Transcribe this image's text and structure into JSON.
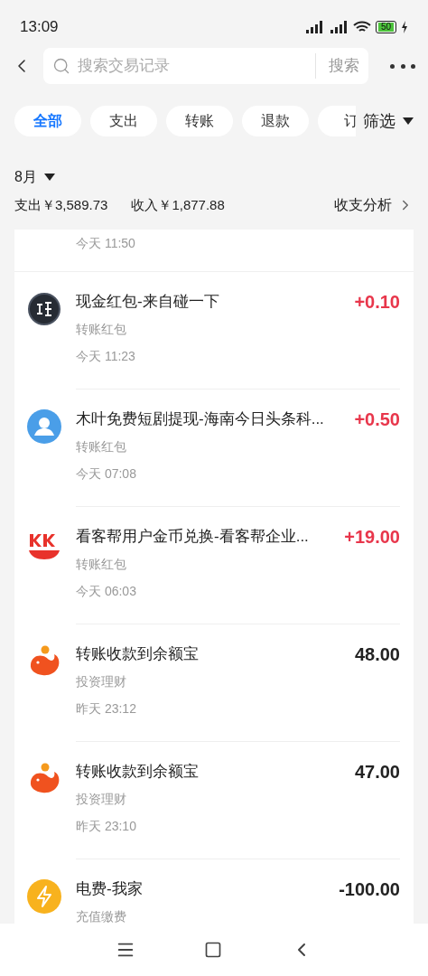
{
  "status_bar": {
    "time": "13:09",
    "battery": "50"
  },
  "search": {
    "placeholder": "搜索交易记录",
    "button": "搜索"
  },
  "chips": [
    {
      "label": "全部",
      "selected": true
    },
    {
      "label": "支出",
      "selected": false
    },
    {
      "label": "转账",
      "selected": false
    },
    {
      "label": "退款",
      "selected": false
    },
    {
      "label": "订",
      "selected": false
    }
  ],
  "filter": "筛选",
  "month": "8月",
  "summary": {
    "expense": "支出￥3,589.73",
    "income": "收入￥1,877.88",
    "analysis": "收支分析"
  },
  "partial_time": "今天 11:50",
  "transactions": [
    {
      "kind": "dark",
      "title": "现金红包-来自碰一下",
      "category": "转账红包",
      "time": "今天 11:23",
      "amount": "+0.10",
      "highlight": true
    },
    {
      "kind": "avatar",
      "title": "木叶免费短剧提现-海南今日头条科...",
      "category": "转账红包",
      "time": "今天 07:08",
      "amount": "+0.50",
      "highlight": true
    },
    {
      "kind": "kkb",
      "title": "看客帮用户金币兑换-看客帮企业...",
      "category": "转账红包",
      "time": "今天 06:03",
      "amount": "+19.00",
      "highlight": true
    },
    {
      "kind": "fish",
      "title": "转账收款到余额宝",
      "category": "投资理财",
      "time": "昨天 23:12",
      "amount": "48.00",
      "highlight": false
    },
    {
      "kind": "fish",
      "title": "转账收款到余额宝",
      "category": "投资理财",
      "time": "昨天 23:10",
      "amount": "47.00",
      "highlight": false
    },
    {
      "kind": "bolt",
      "title": "电费-我家",
      "category": "充值缴费",
      "amount": "-100.00",
      "highlight": false
    }
  ]
}
